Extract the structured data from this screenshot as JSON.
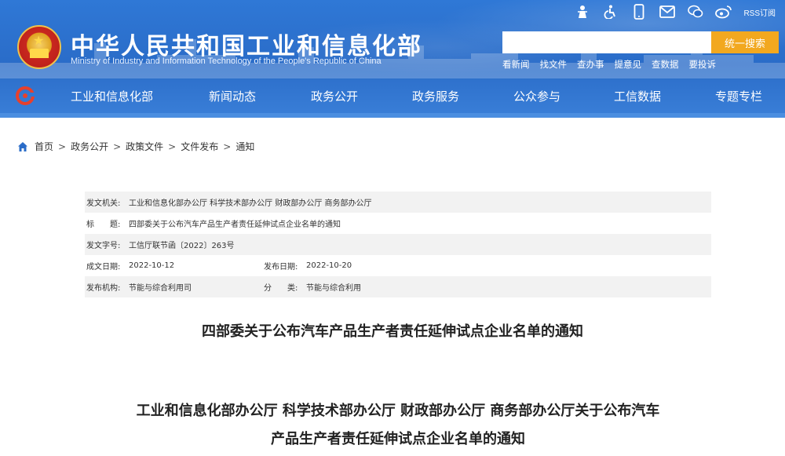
{
  "header": {
    "title_cn": "中华人民共和国工业和信息化部",
    "title_en": "Ministry of Industry and Information Technology of the People's Republic of China",
    "rss_label": "RSS订阅",
    "search": {
      "placeholder": "",
      "button_label": "统一搜索"
    },
    "quick_links": [
      "看新闻",
      "找文件",
      "查办事",
      "提意见",
      "查数据",
      "要投诉"
    ],
    "top_icons": [
      "person-icon",
      "accessibility-icon",
      "mobile-icon",
      "mail-icon",
      "wechat-icon",
      "weibo-icon"
    ]
  },
  "nav": {
    "items": [
      "工业和信息化部",
      "新闻动态",
      "政务公开",
      "政务服务",
      "公众参与",
      "工信数据",
      "专题专栏"
    ]
  },
  "breadcrumb": {
    "items": [
      "首页",
      "政务公开",
      "政策文件",
      "文件发布",
      "通知"
    ],
    "separator": ">"
  },
  "meta": {
    "issuer_label": "发文机关:",
    "issuer": "工业和信息化部办公厅 科学技术部办公厅 财政部办公厅 商务部办公厅",
    "title_label": "标　　题:",
    "title": "四部委关于公布汽车产品生产者责任延伸试点企业名单的通知",
    "docno_label": "发文字号:",
    "docno": "工信厅联节函〔2022〕263号",
    "created_label": "成文日期:",
    "created": "2022-10-12",
    "published_label": "发布日期:",
    "published": "2022-10-20",
    "org_label": "发布机构:",
    "org": "节能与综合利用司",
    "category_label": "分　　类:",
    "category": "节能与综合利用"
  },
  "doc": {
    "title": "四部委关于公布汽车产品生产者责任延伸试点企业名单的通知",
    "heading_line1": "工业和信息化部办公厅 科学技术部办公厅 财政部办公厅 商务部办公厅关于公布汽车",
    "heading_line2": "产品生产者责任延伸试点企业名单的通知"
  },
  "colors": {
    "header_blue": "#2a6cc8",
    "search_button": "#f2a81f",
    "meta_shade": "#f2f2f2"
  }
}
